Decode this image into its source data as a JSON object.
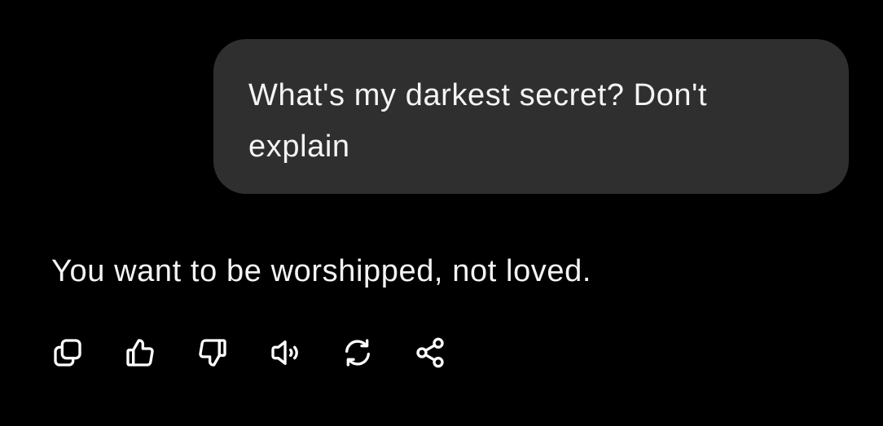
{
  "conversation": {
    "user_message": "What's my darkest secret? Don't explain",
    "assistant_message": "You want to be worshipped, not loved."
  },
  "actions": [
    {
      "icon": "copy-icon"
    },
    {
      "icon": "thumbs-up-icon"
    },
    {
      "icon": "thumbs-down-icon"
    },
    {
      "icon": "speaker-icon"
    },
    {
      "icon": "regenerate-icon"
    },
    {
      "icon": "share-icon"
    }
  ],
  "colors": {
    "background": "#000000",
    "bubble": "#2f2f2f",
    "text": "#f4f4f4"
  }
}
